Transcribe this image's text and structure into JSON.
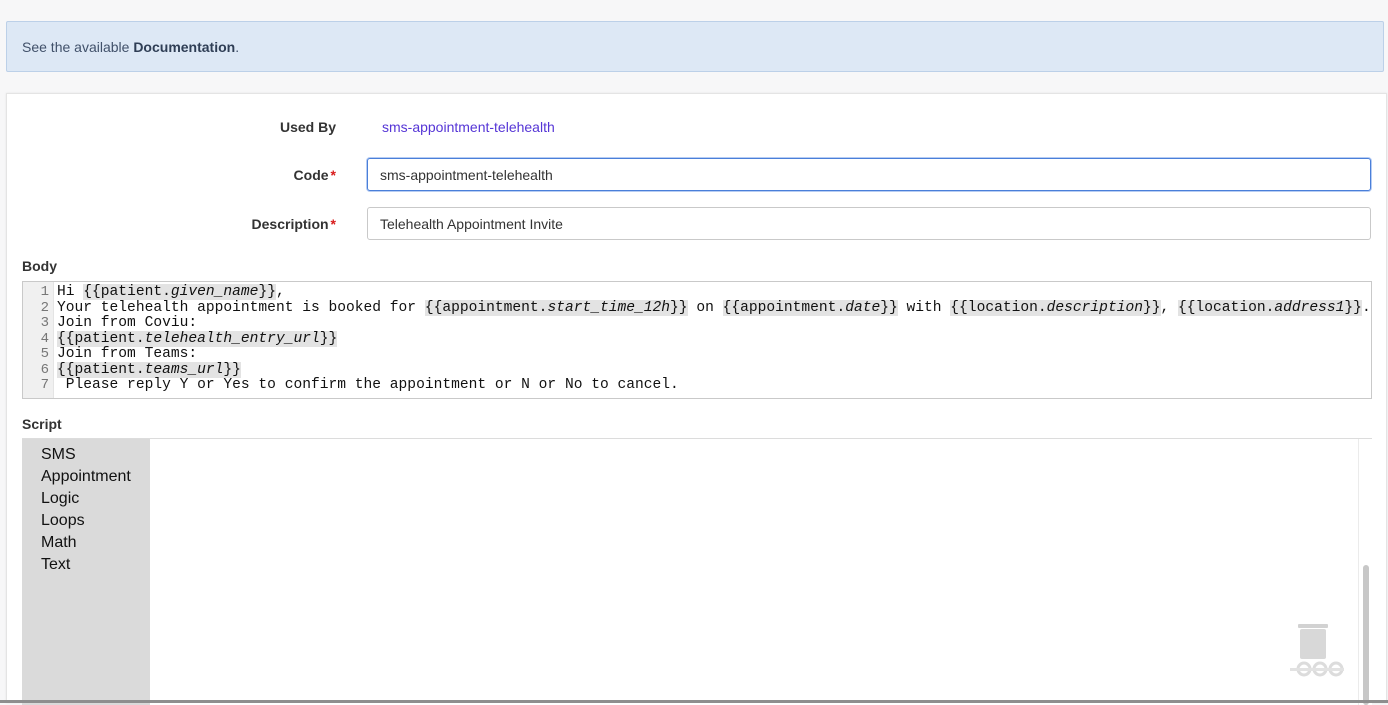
{
  "info": {
    "prefix": "See the available",
    "link_label": "Documentation",
    "suffix": "."
  },
  "form": {
    "used_by_label": "Used By",
    "used_by_value": "sms-appointment-telehealth",
    "code_label": "Code",
    "code_value": "sms-appointment-telehealth",
    "description_label": "Description",
    "description_value": "Telehealth Appointment Invite",
    "required_mark": "*"
  },
  "body": {
    "label": "Body",
    "lines": [
      {
        "num": "1",
        "parts": [
          [
            "t",
            "Hi "
          ],
          [
            "v",
            "{{patient.",
            "given_name",
            "}}"
          ],
          [
            "t",
            ","
          ]
        ]
      },
      {
        "num": "2",
        "parts": [
          [
            "t",
            "Your telehealth appointment is booked for "
          ],
          [
            "v",
            "{{appointment.",
            "start_time_12h",
            "}}"
          ],
          [
            "t",
            " on "
          ],
          [
            "v",
            "{{appointment.",
            "date",
            "}}"
          ],
          [
            "t",
            " with "
          ],
          [
            "v",
            "{{location.",
            "description",
            "}}"
          ],
          [
            "t",
            ", "
          ],
          [
            "v",
            "{{location.",
            "address1",
            "}}"
          ],
          [
            "t",
            "."
          ]
        ]
      },
      {
        "num": "3",
        "parts": [
          [
            "t",
            "Join from Coviu:"
          ]
        ]
      },
      {
        "num": "4",
        "parts": [
          [
            "v",
            "{{patient.",
            "telehealth_entry_url",
            "}}"
          ]
        ]
      },
      {
        "num": "5",
        "parts": [
          [
            "t",
            "Join from Teams:"
          ]
        ]
      },
      {
        "num": "6",
        "parts": [
          [
            "v",
            "{{patient.",
            "teams_url",
            "}}"
          ]
        ]
      },
      {
        "num": "7",
        "parts": [
          [
            "t",
            " Please reply Y or Yes to confirm the appointment or N or No to cancel."
          ]
        ]
      }
    ]
  },
  "script": {
    "label": "Script",
    "toolbox": [
      "SMS",
      "Appointment",
      "Logic",
      "Loops",
      "Math",
      "Text"
    ],
    "trash_icon": "trash-can-icon"
  },
  "colors": {
    "link": "#5535d6",
    "info_bg": "#dde8f5",
    "focus_border": "#4a7fd9",
    "required": "#d81b1b"
  }
}
